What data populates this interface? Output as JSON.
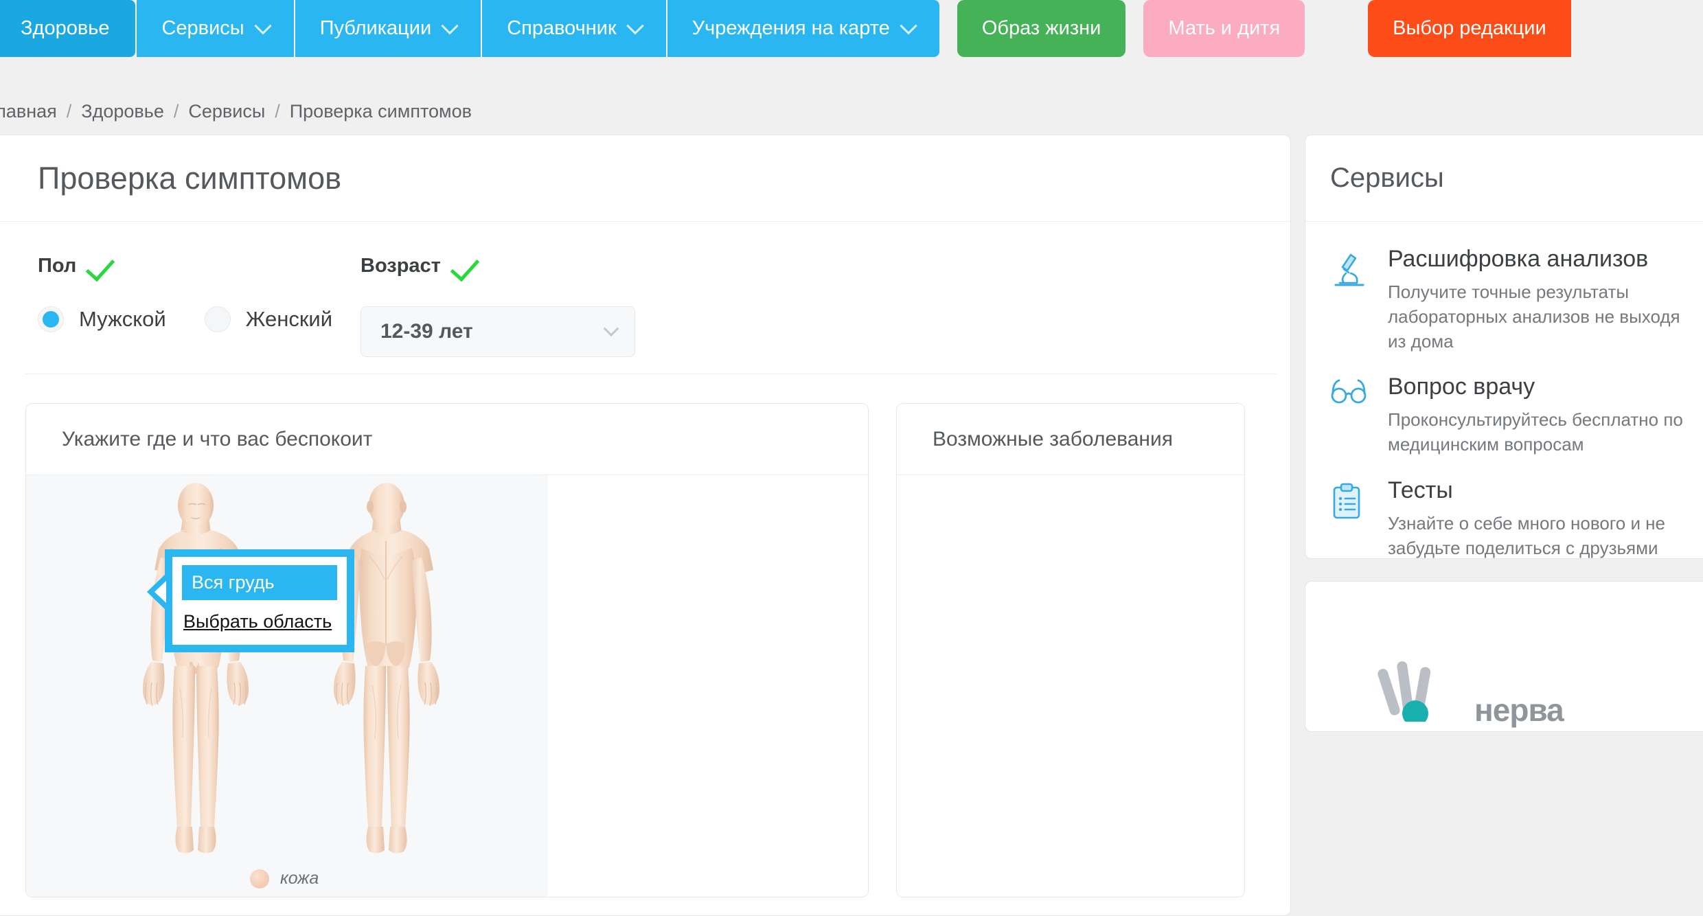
{
  "nav": {
    "items": [
      {
        "label": "Здоровье",
        "has_chevron": false,
        "style": "active-tab"
      },
      {
        "label": "Сервисы",
        "has_chevron": true,
        "style": "tab"
      },
      {
        "label": "Публикации",
        "has_chevron": true,
        "style": "tab"
      },
      {
        "label": "Справочник",
        "has_chevron": true,
        "style": "tab"
      },
      {
        "label": "Учреждения на карте",
        "has_chevron": true,
        "style": "tab"
      }
    ],
    "pills": [
      {
        "label": "Образ жизни",
        "color": "#45b257"
      },
      {
        "label": "Мать и дитя",
        "color": "#fbacc1"
      },
      {
        "label": "Выбор редакции",
        "color": "#fc4c18"
      }
    ],
    "colors": {
      "tab": "#29b6f1",
      "active_tab": "#1ba7e0",
      "text": "#ffffff"
    }
  },
  "breadcrumb": {
    "items": [
      "Главная",
      "Здоровье",
      "Сервисы",
      "Проверка симптомов"
    ],
    "separator": "/"
  },
  "main": {
    "title": "Проверка симптомов",
    "gender": {
      "label": "Пол",
      "valid_icon": "checkmark-icon",
      "options": [
        {
          "label": "Мужской",
          "selected": true
        },
        {
          "label": "Женский",
          "selected": false
        }
      ]
    },
    "age": {
      "label": "Возраст",
      "valid_icon": "checkmark-icon",
      "selected": "12-39 лет",
      "chevron_icon": "chevron-down-icon"
    },
    "body_panel": {
      "title": "Укажите где и что вас беспокоит",
      "figures": [
        {
          "name": "front-body-figure",
          "view": "Вид спереди"
        },
        {
          "name": "back-body-figure",
          "view": "Вид сзади"
        }
      ],
      "legend": {
        "swatch_color": "#f3cdb6",
        "label": "кожа"
      },
      "tooltip": {
        "option": "Вся грудь",
        "link": "Выбрать область",
        "accent": "#29b6f1"
      }
    },
    "disease_panel": {
      "title": "Возможные заболевания",
      "items": []
    }
  },
  "sidebar": {
    "title": "Сервисы",
    "items": [
      {
        "icon": "microscope-icon",
        "title": "Расшифровка анализов",
        "desc": "Получите точные результаты лабораторных анализов не выходя из дома"
      },
      {
        "icon": "glasses-icon",
        "title": "Вопрос врачу",
        "desc": "Проконсультируйтесь бесплатно по медицинским вопросам"
      },
      {
        "icon": "clipboard-icon",
        "title": "Тесты",
        "desc": "Узнайте о себе много нового и не забудьте поделиться с друзьями"
      }
    ],
    "promo": {
      "logo_icon": "fan-logo-icon",
      "word": "нерва"
    }
  }
}
